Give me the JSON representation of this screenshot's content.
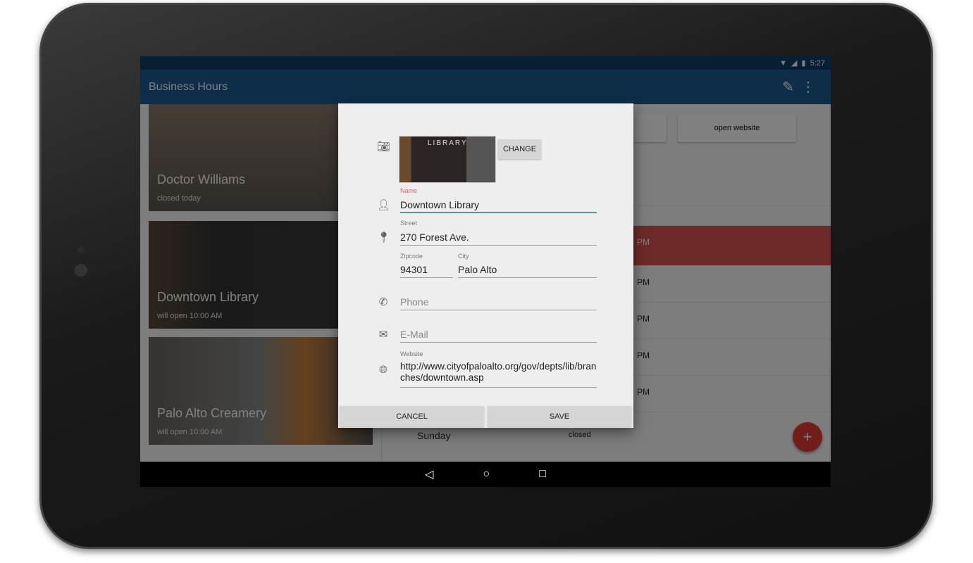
{
  "status_bar": {
    "time": "5:27"
  },
  "toolbar": {
    "title": "Business Hours"
  },
  "cards": [
    {
      "name": "Doctor Williams",
      "status": "closed today"
    },
    {
      "name": "Downtown Library",
      "status": "will open 10:00 AM"
    },
    {
      "name": "Palo Alto Creamery",
      "status": "will open 10:00 AM"
    }
  ],
  "detail": {
    "open_website": "open website",
    "hours": [
      "PM",
      "PM",
      "PM",
      "PM",
      "PM"
    ],
    "sunday": "Sunday",
    "sunday_hours": "closed",
    "fab": "+"
  },
  "dialog": {
    "change": "CHANGE",
    "photo_text": "LIBRARY",
    "name_label": "Name",
    "name": "Downtown Library",
    "street_label": "Street",
    "street": "270 Forest Ave.",
    "zip_label": "Zipcode",
    "zip": "94301",
    "city_label": "City",
    "city": "Palo Alto",
    "phone_placeholder": "Phone",
    "email_placeholder": "E-Mail",
    "website_label": "Website",
    "website": "http://www.cityofpaloalto.org/gov/depts/lib/branches/downtown.asp",
    "cancel": "CANCEL",
    "save": "SAVE"
  },
  "colors": {
    "primary": "#1a5a90",
    "status": "#0d3c66",
    "accent": "#e53935",
    "focus": "#4a9e95",
    "error_label": "#ff5252"
  }
}
